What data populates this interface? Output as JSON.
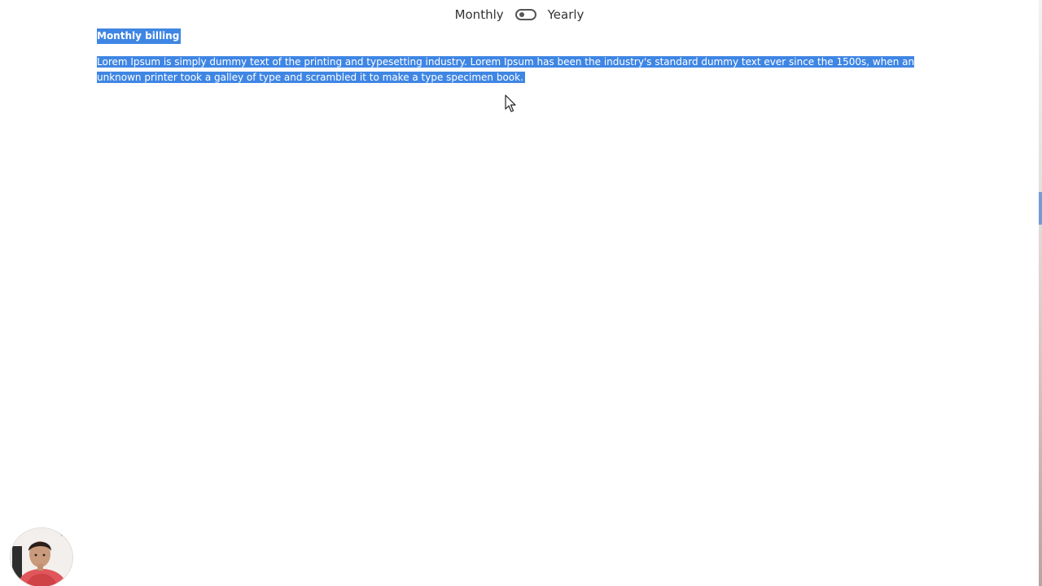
{
  "billing_toggle": {
    "monthly_label": "Monthly",
    "yearly_label": "Yearly",
    "selected": "Monthly"
  },
  "plan": {
    "heading": "Monthly billing",
    "description": "Lorem Ipsum is simply dummy text of the printing and typesetting industry. Lorem Ipsum has been the industry's standard dummy text ever since the 1500s, when an unknown printer took a galley of type and scrambled it to make a type specimen book."
  },
  "icons": {
    "cursor": "mouse-pointer-icon",
    "toggle": "toggle-switch-icon"
  },
  "colors": {
    "selection": "#3f86e4",
    "text": "#333333",
    "switch": "#555555"
  }
}
